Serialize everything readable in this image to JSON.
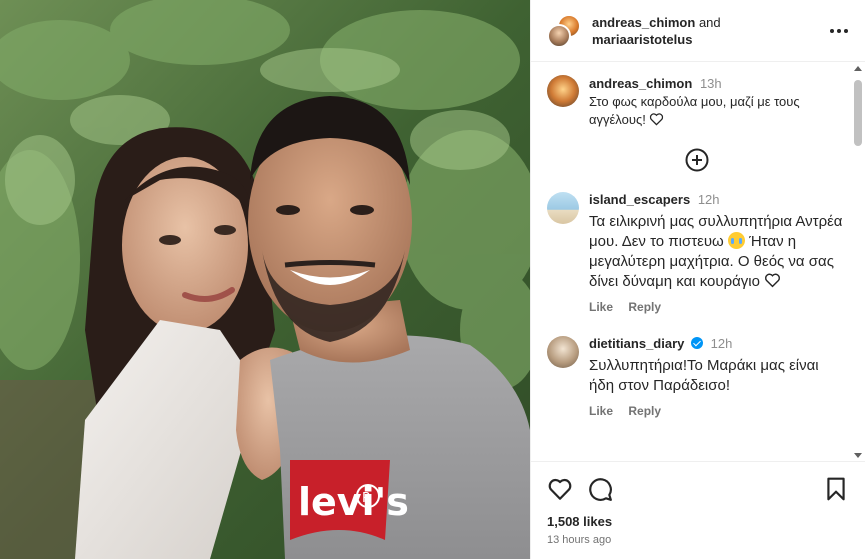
{
  "header": {
    "user1": "andreas_chimon",
    "joiner": "and",
    "user2": "mariaaristotelus"
  },
  "caption": {
    "username": "andreas_chimon",
    "time": "13h",
    "text": "Στο φως καρδούλα μου, μαζί με τους αγγέλους!"
  },
  "comments": [
    {
      "username": "island_escapers",
      "time": "12h",
      "text_a": "Τα ειλικρινή μας συλλυπητήρια Αντρέα μου. Δεν το πιστευω",
      "text_b": "Ήταν η μεγαλύτερη μαχήτρια. Ο θεός να σας δίνει δύναμη και κουράγιο",
      "like": "Like",
      "reply": "Reply"
    },
    {
      "username": "dietitians_diary",
      "time": "12h",
      "text": "Συλλυπητήρια!Το Μαράκι μας είναι ήδη στον Παράδεισο!",
      "like": "Like",
      "reply": "Reply"
    }
  ],
  "footer": {
    "likes": "1,508 likes",
    "ago": "13 hours ago"
  },
  "photo": {
    "shirt_logo": "levi's",
    "registered_mark": "R"
  },
  "icons": {
    "more": "more-horizontal-icon",
    "load_more": "plus-circle-icon",
    "like": "heart-icon",
    "comment": "comment-icon",
    "save": "bookmark-icon"
  }
}
